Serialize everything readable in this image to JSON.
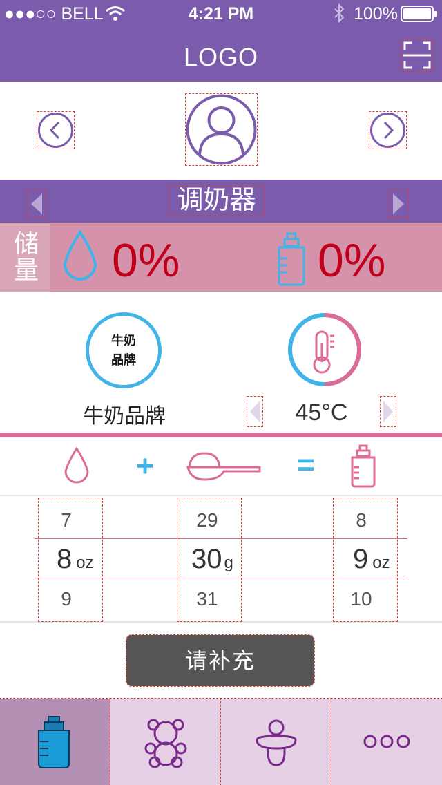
{
  "status_bar": {
    "carrier": "●●●○○ BELL",
    "time": "4:21 PM",
    "battery": "100%",
    "icons": [
      "wifi-icon",
      "bluetooth-icon",
      "battery-icon"
    ]
  },
  "header": {
    "logo": "LOGO",
    "scan_icon": "scan-icon"
  },
  "profile": {
    "avatar_icon": "user-avatar-icon",
    "prev_icon": "chevron-left-icon",
    "next_icon": "chevron-right-icon"
  },
  "device_bar": {
    "title": "调奶器",
    "prev_icon": "triangle-left-icon",
    "next_icon": "triangle-right-icon"
  },
  "storage": {
    "label_line1": "储",
    "label_line2": "量",
    "water_percent": "0%",
    "milk_percent": "0%"
  },
  "brand": {
    "badge_line1": "牛奶",
    "badge_line2": "品牌",
    "label": "牛奶品牌"
  },
  "temperature": {
    "value": "45°C",
    "level": 0.5
  },
  "formula": {
    "plus": "+",
    "equals": "=",
    "icons": [
      "water-drop-icon",
      "scoop-icon",
      "baby-bottle-icon"
    ]
  },
  "pickers": {
    "water": {
      "above": "7",
      "selected": "8",
      "unit": "oz",
      "below": "9"
    },
    "powder": {
      "above": "29",
      "selected": "30",
      "unit": "g",
      "below": "31"
    },
    "milk": {
      "above": "8",
      "selected": "9",
      "unit": "oz",
      "below": "10"
    }
  },
  "action": {
    "refill_label": "请补充"
  },
  "tabs": [
    {
      "icon": "bottle-tab-icon",
      "active": true
    },
    {
      "icon": "teddy-bear-icon",
      "active": false
    },
    {
      "icon": "pacifier-icon",
      "active": false
    },
    {
      "icon": "more-dots-icon",
      "active": false
    }
  ],
  "colors": {
    "header": "#7b5bac",
    "storage_band": "#d592ab",
    "accent_blue": "#40b4e6",
    "accent_pink": "#dd6b98",
    "button": "#555555",
    "tab_active": "#b48fb4",
    "tab_bg": "#e6d0e6"
  }
}
